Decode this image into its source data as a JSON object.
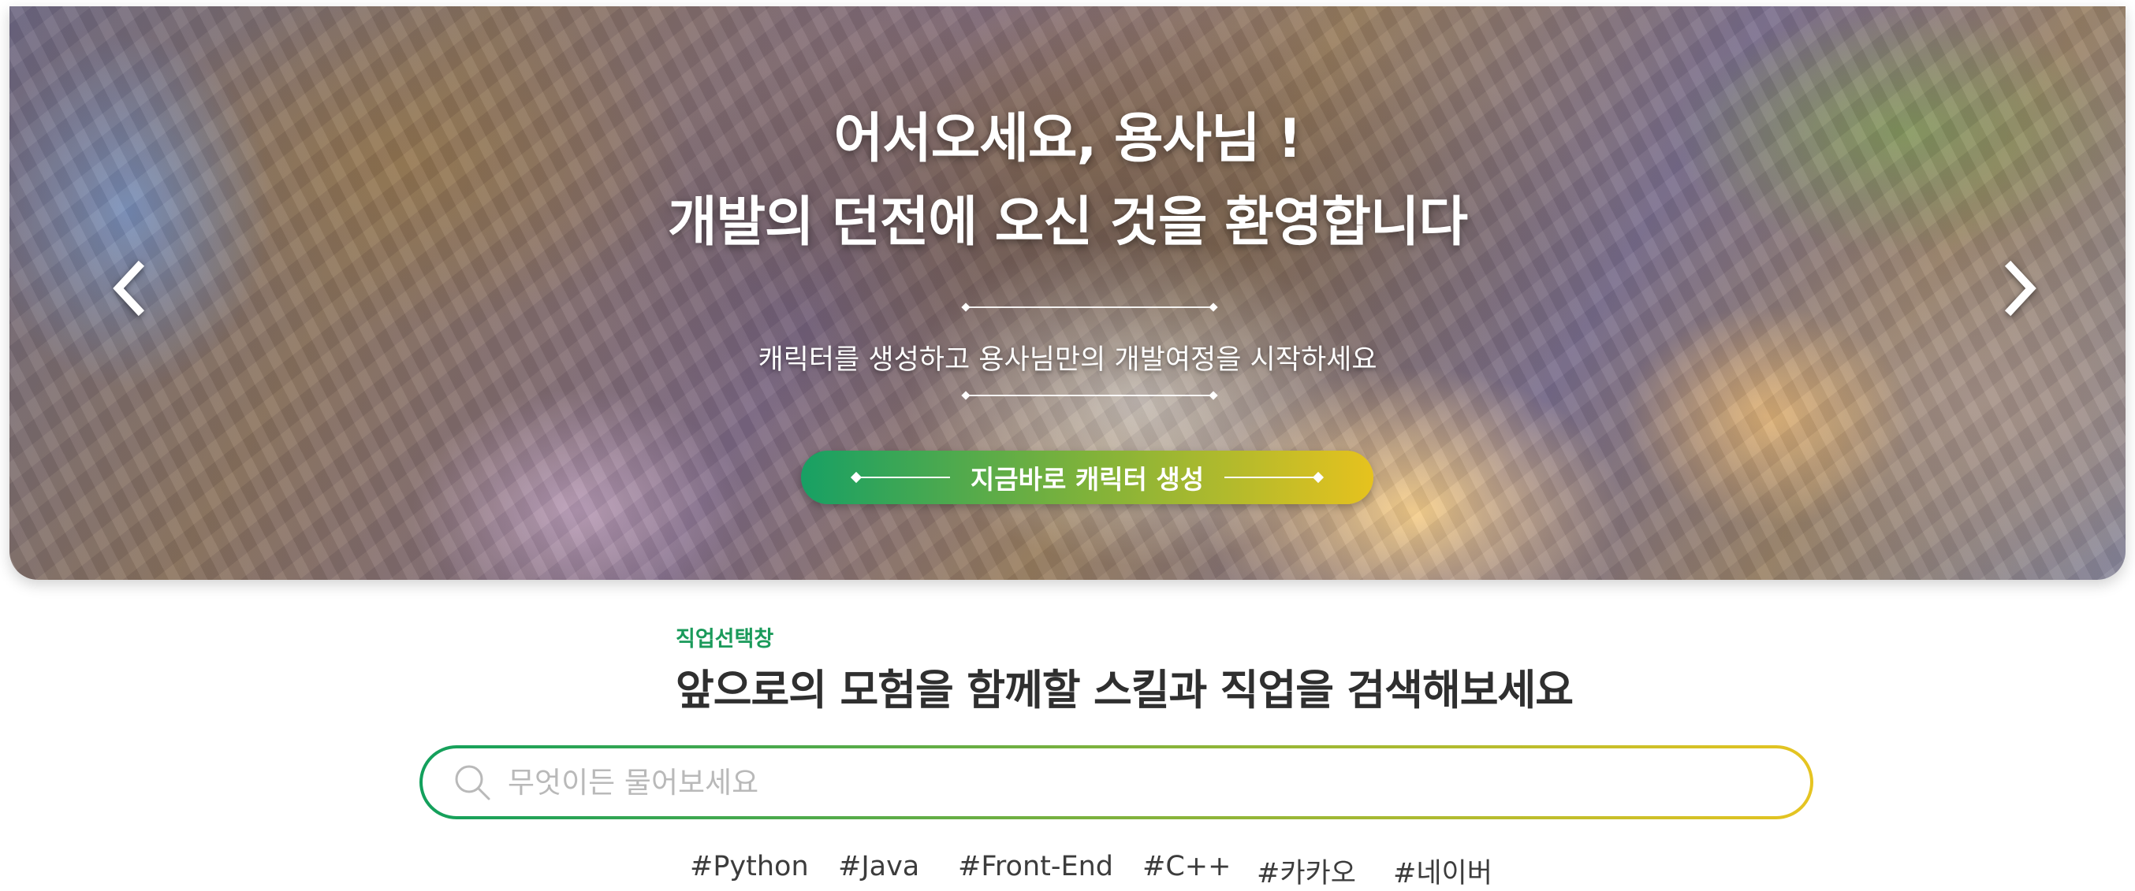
{
  "hero": {
    "title_line1": "어서오세요, 용사님 !",
    "title_line2": "개발의 던전에 오신 것을 환영합니다",
    "subtitle": "캐릭터를 생성하고 용사님만의 개발여정을 시작하세요",
    "cta_label": "지금바로 캐릭터 생성",
    "prev_icon": "chevron-left-icon",
    "next_icon": "chevron-right-icon"
  },
  "job_search": {
    "label": "직업선택창",
    "title": "앞으로의 모험을 함께할 스킬과 직업을 검색해보세요",
    "search_placeholder": "무엇이든 물어보세요",
    "search_value": "",
    "search_icon": "search-icon",
    "tags": [
      "#Python",
      "#Java",
      "#Front-End",
      "#C++",
      "#카카오",
      "#네이버"
    ]
  },
  "colors": {
    "accent_green": "#17a064",
    "accent_yellow": "#e6c21e",
    "label_green": "#1a9a5a",
    "title_text": "#2f2f2f"
  }
}
